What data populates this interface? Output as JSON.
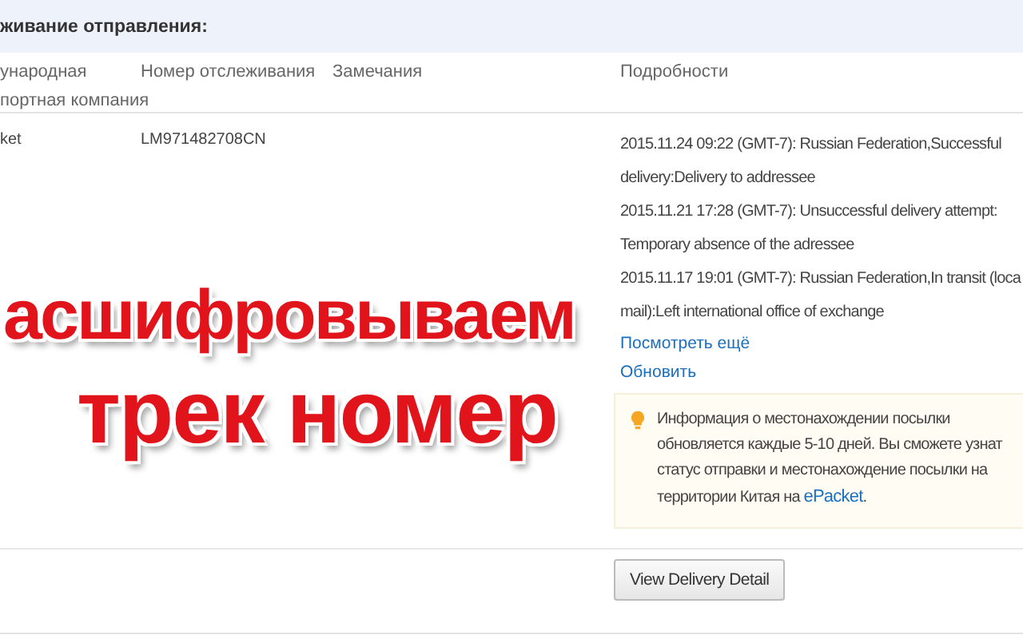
{
  "section": {
    "title": "живание отправления:"
  },
  "table": {
    "columns": [
      {
        "lines": [
          "ународная",
          "портная компания"
        ]
      },
      {
        "lines": [
          "Номер отслеживания"
        ]
      },
      {
        "lines": [
          "Замечания"
        ]
      },
      {
        "lines": [
          "Подробности"
        ]
      }
    ],
    "rows": [
      {
        "carrier": "ket",
        "tracking_number": "LM971482708CN",
        "events": [
          {
            "lines": [
              "2015.11.24 09:22 (GMT-7): Russian Federation,Successful",
              "delivery:Delivery to addressee"
            ]
          },
          {
            "lines": [
              "2015.11.21 17:28 (GMT-7): Unsuccessful delivery attempt:",
              "Temporary absence of the adressee"
            ]
          },
          {
            "lines": [
              "2015.11.17 19:01 (GMT-7): Russian Federation,In transit (loca",
              "mail):Left international office of exchange"
            ]
          }
        ],
        "links": [
          "Посмотреть ещё",
          "Обновить"
        ],
        "notice": {
          "lines": [
            "Информация о местонахождении посылки",
            "обновляется каждые 5-10 дней. Вы сможете узнат",
            "статус отправки и местонахождение посылки на",
            "территории Китая на "
          ],
          "link": "ePacket",
          "tail": "."
        }
      }
    ]
  },
  "button": {
    "label": "View Delivery Detail"
  },
  "overlay": {
    "lines": [
      "асшифровываем",
      "трек номер"
    ]
  }
}
